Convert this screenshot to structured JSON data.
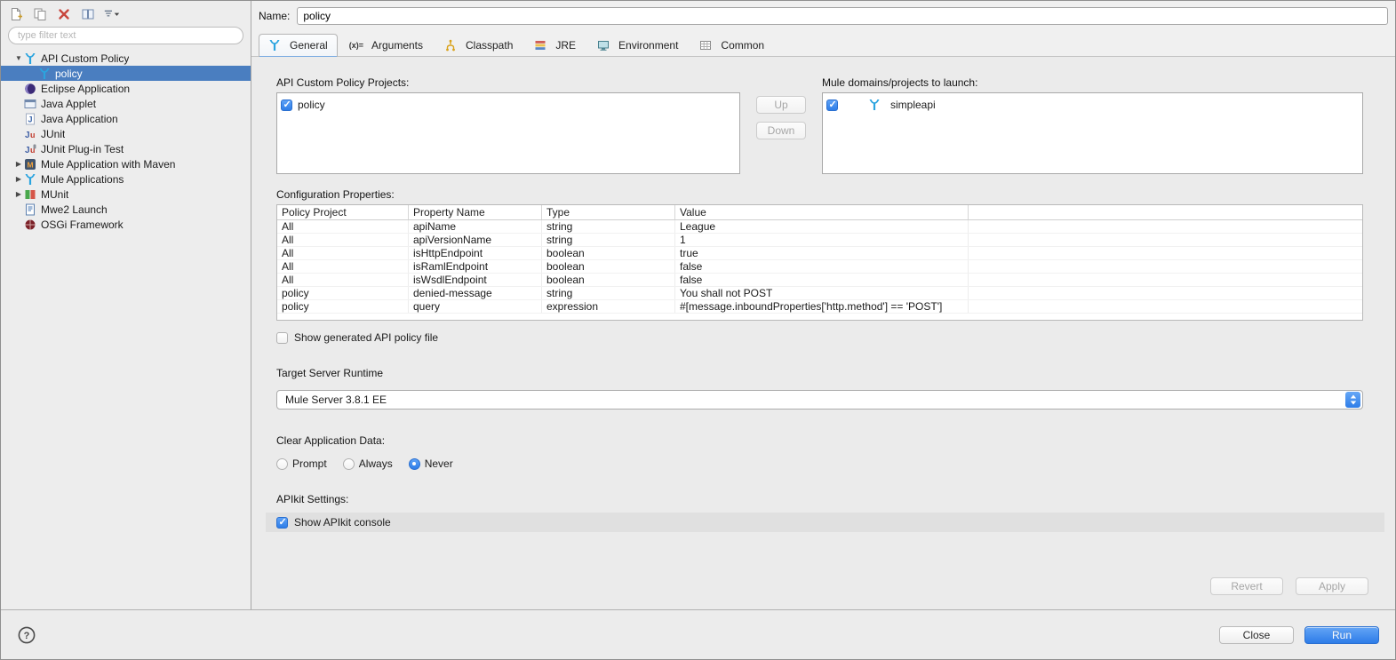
{
  "colors": {
    "selection_blue": "#4a7ec0",
    "accent_blue": "#2e7de8",
    "content_background": "#ebebeb"
  },
  "icons": {
    "combo_stepper": "up-down-arrows",
    "help": "question-mark"
  },
  "sidebar": {
    "toolbar_icons": [
      "new-config",
      "duplicate-config",
      "delete-config",
      "collapse-all",
      "filter-menu"
    ],
    "filter_placeholder": "type filter text",
    "tree": [
      {
        "label": "API Custom Policy",
        "icon": "mule",
        "depth": 0,
        "disclosure": "expanded"
      },
      {
        "label": "policy",
        "icon": "mule",
        "depth": 1,
        "selected": true
      },
      {
        "label": "Eclipse Application",
        "icon": "eclipse",
        "depth": 0
      },
      {
        "label": "Java Applet",
        "icon": "applet",
        "depth": 0
      },
      {
        "label": "Java Application",
        "icon": "java",
        "depth": 0
      },
      {
        "label": "JUnit",
        "icon": "junit",
        "depth": 0
      },
      {
        "label": "JUnit Plug-in Test",
        "icon": "junit-plugin",
        "depth": 0
      },
      {
        "label": "Mule Application with Maven",
        "icon": "maven",
        "depth": 0,
        "disclosure": "collapsed"
      },
      {
        "label": "Mule Applications",
        "icon": "mule",
        "depth": 0,
        "disclosure": "collapsed"
      },
      {
        "label": "MUnit",
        "icon": "munit",
        "depth": 0,
        "disclosure": "collapsed"
      },
      {
        "label": "Mwe2 Launch",
        "icon": "mwe2",
        "depth": 0
      },
      {
        "label": "OSGi Framework",
        "icon": "osgi",
        "depth": 0
      }
    ]
  },
  "header": {
    "name_label": "Name:",
    "name_value": "policy"
  },
  "tabs": [
    {
      "label": "General",
      "icon": "mule",
      "active": true
    },
    {
      "label": "Arguments",
      "icon": "arguments"
    },
    {
      "label": "Classpath",
      "icon": "classpath"
    },
    {
      "label": "JRE",
      "icon": "jre"
    },
    {
      "label": "Environment",
      "icon": "environment"
    },
    {
      "label": "Common",
      "icon": "common"
    }
  ],
  "general_tab": {
    "policy_projects": {
      "label": "API Custom Policy Projects:",
      "items": [
        {
          "label": "policy",
          "checked": true
        }
      ],
      "up_button": "Up",
      "down_button": "Down",
      "buttons_enabled": false
    },
    "mule_domains": {
      "label": "Mule domains/projects to launch:",
      "items": [
        {
          "label": "simpleapi",
          "checked": true,
          "icon": "mule"
        }
      ]
    },
    "configuration_properties": {
      "label": "Configuration Properties:",
      "columns": [
        "Policy Project",
        "Property Name",
        "Type",
        "Value"
      ],
      "rows": [
        [
          "All",
          "apiName",
          "string",
          "League"
        ],
        [
          "All",
          "apiVersionName",
          "string",
          "1"
        ],
        [
          "All",
          "isHttpEndpoint",
          "boolean",
          "true"
        ],
        [
          "All",
          "isRamlEndpoint",
          "boolean",
          "false"
        ],
        [
          "All",
          "isWsdlEndpoint",
          "boolean",
          "false"
        ],
        [
          "policy",
          "denied-message",
          "string",
          "You shall not POST"
        ],
        [
          "policy",
          "query",
          "expression",
          "#[message.inboundProperties['http.method'] == 'POST']"
        ]
      ]
    },
    "show_generated_policy": {
      "label": "Show generated API policy file",
      "checked": false
    },
    "target_server": {
      "label": "Target Server Runtime",
      "value": "Mule Server 3.8.1 EE"
    },
    "clear_application_data": {
      "label": "Clear Application Data:",
      "options": [
        "Prompt",
        "Always",
        "Never"
      ],
      "selected": "Never"
    },
    "apikit": {
      "label": "APIkit Settings:",
      "console_checkbox": {
        "label": "Show APIkit console",
        "checked": true
      }
    }
  },
  "actions": {
    "revert": "Revert",
    "apply": "Apply",
    "close": "Close",
    "run": "Run",
    "revert_enabled": false,
    "apply_enabled": false
  }
}
